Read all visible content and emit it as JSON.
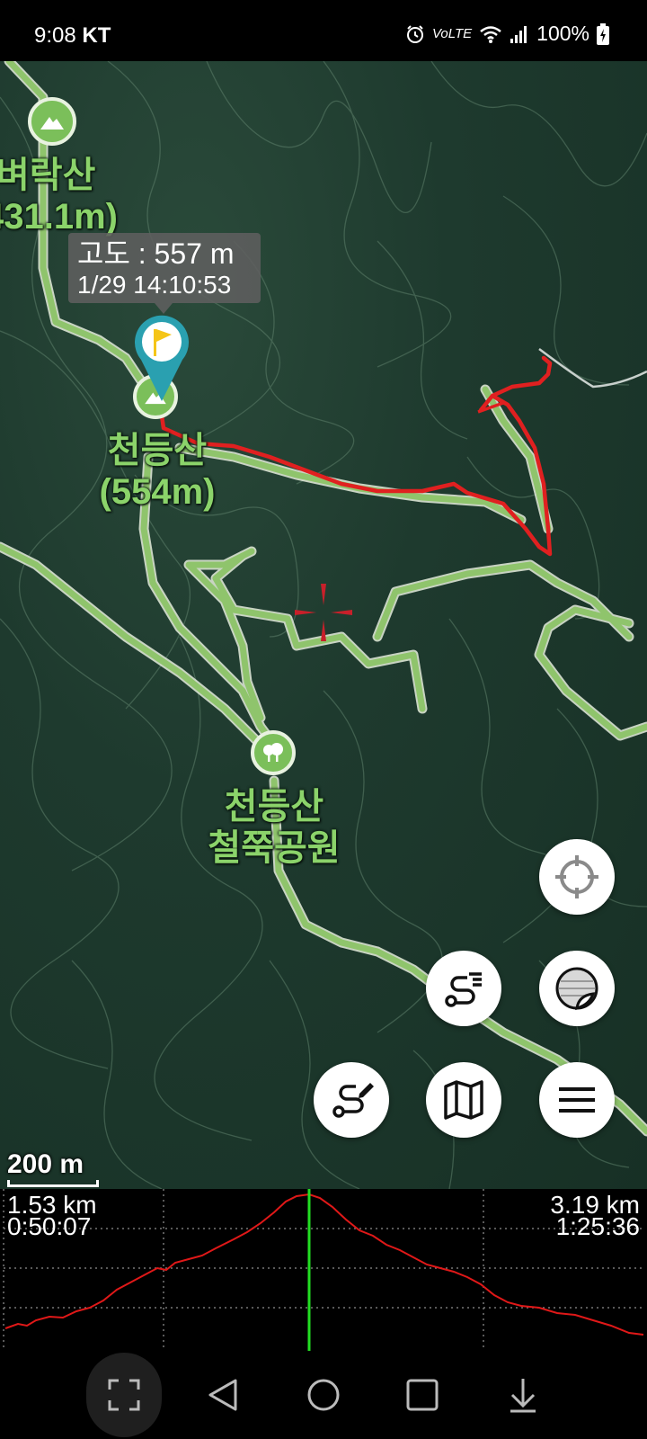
{
  "status_bar": {
    "time": "9:08",
    "carrier": "KT",
    "volte": "VoLTE",
    "battery": "100%"
  },
  "map": {
    "tooltip": {
      "altitude": "고도 : 557 m",
      "datetime": "1/29 14:10:53"
    },
    "labels": {
      "peak1_name": "벼락산",
      "peak1_height": "431.1m)",
      "peak2_name": "천등산",
      "peak2_height": "(554m)",
      "park_line1": "천등산",
      "park_line2": "철쭉공원"
    },
    "scale_label": "200 m",
    "colors": {
      "trail": "#8fc46c",
      "track": "#e02020",
      "marker": "#2aa0b0",
      "flag": "#f5c518"
    }
  },
  "profile": {
    "left_distance": "1.53 km",
    "left_time": "0:50:07",
    "right_distance": "3.19 km",
    "right_time": "1:25:36"
  }
}
